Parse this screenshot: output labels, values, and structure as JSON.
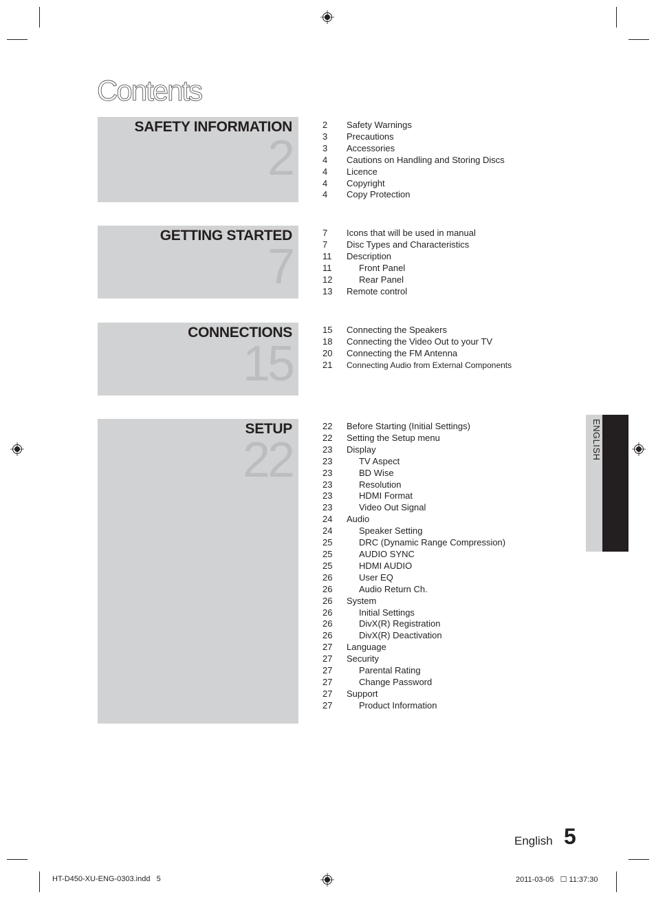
{
  "page_title": "Contents",
  "sections": [
    {
      "title": "SAFETY INFORMATION",
      "start_page": "2",
      "entries": [
        {
          "page": "2",
          "label": "Safety Warnings",
          "level": 1
        },
        {
          "page": "3",
          "label": "Precautions",
          "level": 1
        },
        {
          "page": "3",
          "label": "Accessories",
          "level": 1
        },
        {
          "page": "4",
          "label": "Cautions on Handling and Storing Discs",
          "level": 1
        },
        {
          "page": "4",
          "label": "Licence",
          "level": 1
        },
        {
          "page": "4",
          "label": "Copyright",
          "level": 1
        },
        {
          "page": "4",
          "label": "Copy Protection",
          "level": 1
        }
      ]
    },
    {
      "title": "GETTING STARTED",
      "start_page": "7",
      "entries": [
        {
          "page": "7",
          "label": "Icons that will be used in manual",
          "level": 1
        },
        {
          "page": "7",
          "label": "Disc Types and Characteristics",
          "level": 1
        },
        {
          "page": "11",
          "label": "Description",
          "level": 1
        },
        {
          "page": "11",
          "label": "Front Panel",
          "level": 2
        },
        {
          "page": "12",
          "label": "Rear Panel",
          "level": 2
        },
        {
          "page": "13",
          "label": "Remote control",
          "level": 1
        }
      ]
    },
    {
      "title": "CONNECTIONS",
      "start_page": "15",
      "entries": [
        {
          "page": "15",
          "label": "Connecting the Speakers",
          "level": 1
        },
        {
          "page": "18",
          "label": "Connecting the Video Out to your TV",
          "level": 1
        },
        {
          "page": "20",
          "label": "Connecting the FM Antenna",
          "level": 1
        },
        {
          "page": "21",
          "label": "Connecting Audio from External Components",
          "level": 1
        }
      ]
    },
    {
      "title": "SETUP",
      "start_page": "22",
      "entries": [
        {
          "page": "22",
          "label": "Before Starting (Initial Settings)",
          "level": 1
        },
        {
          "page": "22",
          "label": "Setting the Setup menu",
          "level": 1
        },
        {
          "page": "23",
          "label": "Display",
          "level": 1
        },
        {
          "page": "23",
          "label": "TV Aspect",
          "level": 2
        },
        {
          "page": "23",
          "label": "BD Wise",
          "level": 2
        },
        {
          "page": "23",
          "label": "Resolution",
          "level": 2
        },
        {
          "page": "23",
          "label": "HDMI Format",
          "level": 2
        },
        {
          "page": "23",
          "label": "Video Out Signal",
          "level": 2
        },
        {
          "page": "24",
          "label": "Audio",
          "level": 1
        },
        {
          "page": "24",
          "label": "Speaker Setting",
          "level": 2
        },
        {
          "page": "25",
          "label": "DRC (Dynamic Range Compression)",
          "level": 2
        },
        {
          "page": "25",
          "label": "AUDIO SYNC",
          "level": 2
        },
        {
          "page": "25",
          "label": "HDMI AUDIO",
          "level": 2
        },
        {
          "page": "26",
          "label": "User EQ",
          "level": 2
        },
        {
          "page": "26",
          "label": "Audio Return Ch.",
          "level": 2
        },
        {
          "page": "26",
          "label": "System",
          "level": 1
        },
        {
          "page": "26",
          "label": "Initial Settings",
          "level": 2
        },
        {
          "page": "26",
          "label": "DivX(R) Registration",
          "level": 2
        },
        {
          "page": "26",
          "label": "DivX(R) Deactivation",
          "level": 2
        },
        {
          "page": "27",
          "label": "Language",
          "level": 1
        },
        {
          "page": "27",
          "label": "Security",
          "level": 1
        },
        {
          "page": "27",
          "label": "Parental Rating",
          "level": 2
        },
        {
          "page": "27",
          "label": "Change Password",
          "level": 2
        },
        {
          "page": "27",
          "label": "Support",
          "level": 1
        },
        {
          "page": "27",
          "label": "Product Information",
          "level": 2
        }
      ]
    }
  ],
  "side_tab": {
    "label": "ENGLISH"
  },
  "footer": {
    "language": "English",
    "page_number": "5"
  },
  "slug": {
    "file": "HT-D450-XU-ENG-0303.indd   5",
    "timestamp": "2011-03-05   ☐ 11:37:30"
  },
  "colors": {
    "panel_gray": "#d1d2d3",
    "number_gray": "#bcbdbf",
    "text_dark": "#231f20"
  }
}
